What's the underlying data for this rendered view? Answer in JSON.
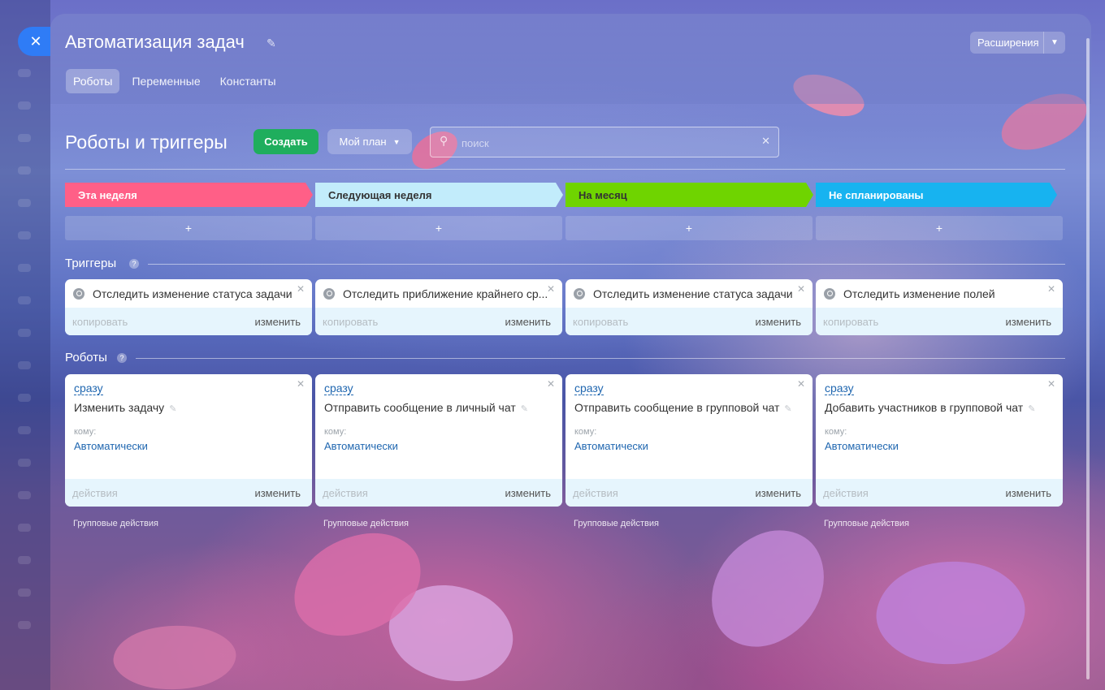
{
  "header": {
    "title": "Автоматизация задач",
    "extensions_label": "Расширения",
    "tabs": [
      {
        "label": "Роботы",
        "active": true
      },
      {
        "label": "Переменные",
        "active": false
      },
      {
        "label": "Константы",
        "active": false
      }
    ]
  },
  "toolbar": {
    "section_title": "Роботы и триггеры",
    "create_label": "Создать",
    "plan_label": "Мой план",
    "search_placeholder": "поиск"
  },
  "columns": [
    {
      "label": "Эта неделя",
      "color": "#ff5f87",
      "text_color": "#ffffff"
    },
    {
      "label": "Следующая неделя",
      "color": "#c2ecfb",
      "text_color": "#333333"
    },
    {
      "label": "На месяц",
      "color": "#6fd400",
      "text_color": "#333333"
    },
    {
      "label": "Не спланированы",
      "color": "#17b3f0",
      "text_color": "#ffffff"
    }
  ],
  "add_symbol": "+",
  "triggers": {
    "label": "Триггеры",
    "help": "?",
    "items": [
      {
        "title": "Отследить изменение статуса задачи",
        "copy_label": "копировать",
        "edit_label": "изменить"
      },
      {
        "title": "Отследить приближение крайнего ср...",
        "copy_label": "копировать",
        "edit_label": "изменить"
      },
      {
        "title": "Отследить изменение статуса задачи",
        "copy_label": "копировать",
        "edit_label": "изменить"
      },
      {
        "title": "Отследить изменение полей",
        "copy_label": "копировать",
        "edit_label": "изменить"
      }
    ]
  },
  "robots": {
    "label": "Роботы",
    "help": "?",
    "items": [
      {
        "when": "сразу",
        "title": "Изменить задачу",
        "to_label": "кому:",
        "to_value": "Автоматически",
        "actions_label": "действия",
        "edit_label": "изменить",
        "group_actions": "Групповые действия"
      },
      {
        "when": "сразу",
        "title": "Отправить сообщение в личный чат",
        "to_label": "кому:",
        "to_value": "Автоматически",
        "actions_label": "действия",
        "edit_label": "изменить",
        "group_actions": "Групповые действия"
      },
      {
        "when": "сразу",
        "title": "Отправить сообщение в групповой чат",
        "to_label": "кому:",
        "to_value": "Автоматически",
        "actions_label": "действия",
        "edit_label": "изменить",
        "group_actions": "Групповые действия"
      },
      {
        "when": "сразу",
        "title": "Добавить участников в групповой чат",
        "to_label": "кому:",
        "to_value": "Автоматически",
        "actions_label": "действия",
        "edit_label": "изменить",
        "group_actions": "Групповые действия"
      }
    ]
  },
  "icons": {
    "close": "close-icon",
    "pin": "pin-icon",
    "search": "search-icon",
    "clear": "clear-icon",
    "chevron": "chevron-down-icon",
    "edit": "pencil-icon"
  }
}
